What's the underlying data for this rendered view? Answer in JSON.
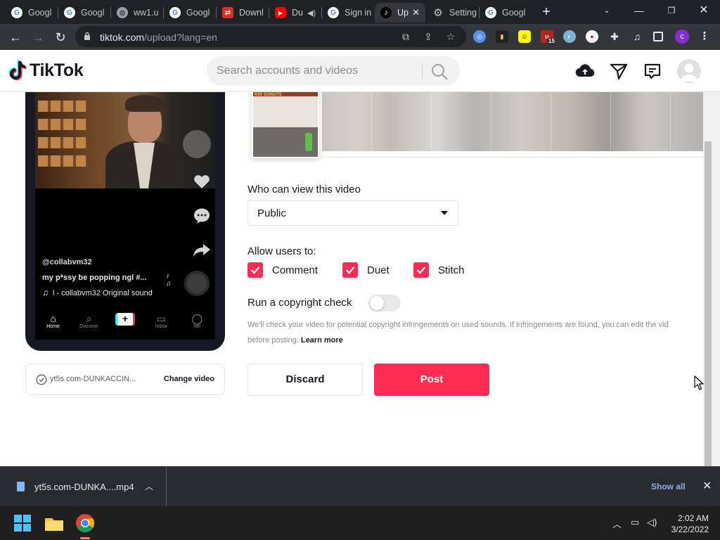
{
  "browser": {
    "tabs": [
      {
        "title": "Googl",
        "favicon": "google-icon"
      },
      {
        "title": "Googl",
        "favicon": "google-icon"
      },
      {
        "title": "ww1.u",
        "favicon": "globe-icon"
      },
      {
        "title": "Googl",
        "favicon": "google-icon"
      },
      {
        "title": "Downl",
        "favicon": "download-site-icon"
      },
      {
        "title": "Du",
        "favicon": "youtube-icon"
      },
      {
        "title": "Sign in",
        "favicon": "google-icon"
      },
      {
        "title": "Up",
        "favicon": "tiktok-icon",
        "active": true
      },
      {
        "title": "Setting",
        "favicon": "gear-icon"
      },
      {
        "title": "Googl",
        "favicon": "google-icon"
      }
    ],
    "url_host": "tiktok.com",
    "url_path": "/upload?lang=en",
    "profile_initial": "c",
    "extension_badge": "15"
  },
  "tiktok": {
    "logo_text": "TikTok",
    "search_placeholder": "Search accounts and videos"
  },
  "preview": {
    "username": "@collabvm32",
    "caption": "my p*ssy be popping ngl #...",
    "sound": "l - collabvm32 Original sound",
    "nav": [
      {
        "label": "Home",
        "glyph": "⌂"
      },
      {
        "label": "Discover",
        "glyph": "⌕"
      },
      {
        "label": "",
        "glyph": "+"
      },
      {
        "label": "Inbox",
        "glyph": "▭"
      },
      {
        "label": "Me",
        "glyph": "◯"
      }
    ],
    "thumb_sign": "KIN' DONUTS"
  },
  "file_card": {
    "filename": "yt5s.com-DUNKACCIN...",
    "change_label": "Change video"
  },
  "form": {
    "privacy_label": "Who can view this video",
    "privacy_value": "Public",
    "allow_label": "Allow users to:",
    "allow_options": [
      {
        "label": "Comment",
        "checked": true
      },
      {
        "label": "Duet",
        "checked": true
      },
      {
        "label": "Stitch",
        "checked": true
      }
    ],
    "copyright_label": "Run a copyright check",
    "copyright_enabled": false,
    "copyright_note_line1": "We'll check your video for potential copyright infringements on used sounds. If infringements are found, you can edit the vid",
    "copyright_note_line2": "before posting.",
    "learn_more": "Learn more",
    "discard_label": "Discard",
    "post_label": "Post",
    "accent_color": "#fe2c55"
  },
  "downloads": {
    "filename": "yt5s.com-DUNKA....mp4",
    "show_all": "Show all"
  },
  "taskbar": {
    "time": "2:02 AM",
    "date": "3/22/2022"
  }
}
